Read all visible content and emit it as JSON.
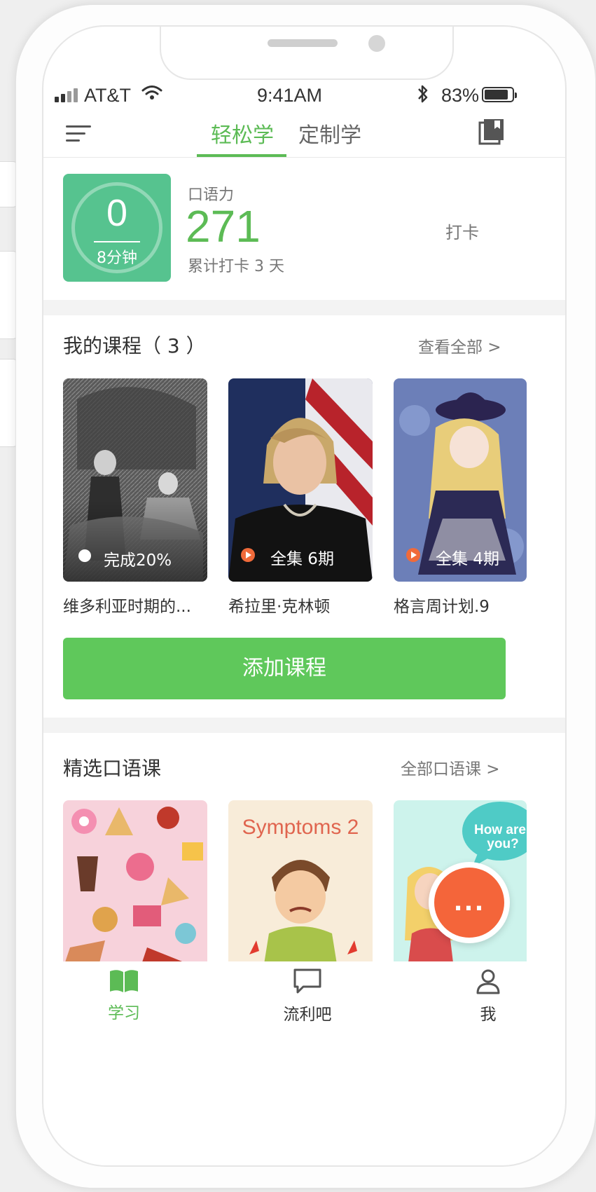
{
  "status_bar": {
    "carrier": "AT&T",
    "time": "9:41AM",
    "battery": "83%"
  },
  "nav": {
    "tabs": [
      "轻松学",
      "定制学"
    ]
  },
  "stats": {
    "minutes_value": "0",
    "minutes_label": "8分钟",
    "oral_label": "口语力",
    "oral_value": "271",
    "checkin_days": "累计打卡 3 天",
    "checkin_button": "打卡"
  },
  "my_courses": {
    "title": "我的课程（ 3 ）",
    "view_all": "查看全部 >",
    "items": [
      {
        "overlay": "完成20%",
        "title": "维多利亚时期的..."
      },
      {
        "overlay": "全集 6期",
        "title": "希拉里·克林顿"
      },
      {
        "overlay": "全集 4期",
        "title": "格言周计划.9"
      }
    ],
    "add_button": "添加课程"
  },
  "featured": {
    "title": "精选口语课",
    "view_all": "全部口语课 >",
    "items": [
      {
        "image_text": ""
      },
      {
        "image_text": "Symptoms 2"
      },
      {
        "image_text": "How are you?"
      }
    ]
  },
  "fab_label": "...",
  "bottom_nav": [
    "学习",
    "流利吧",
    "我"
  ],
  "colors": {
    "accent": "#5cbb55",
    "score_box": "#56c38f",
    "fab": "#f4653a"
  }
}
